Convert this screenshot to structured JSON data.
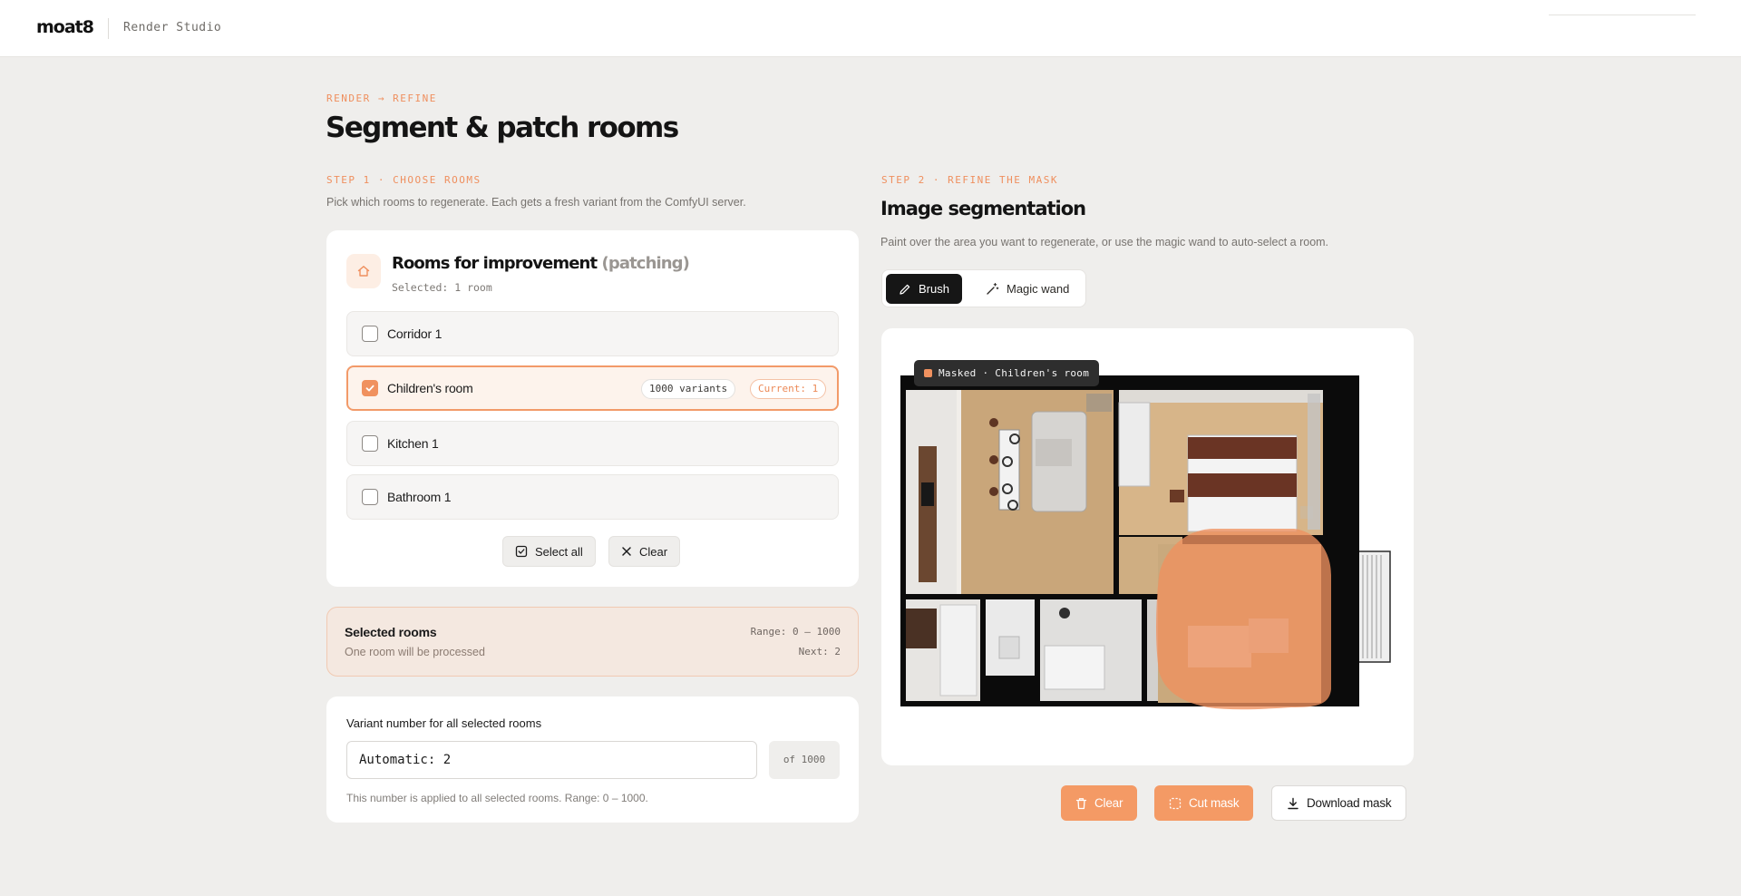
{
  "header": {
    "logo": "moat8",
    "app_name": "Render Studio"
  },
  "breadcrumb": "RENDER → REFINE",
  "page_title": "Segment & patch rooms",
  "step1": {
    "eyebrow": "STEP 1 · CHOOSE ROOMS",
    "description": "Pick which rooms to regenerate. Each gets a fresh variant from the ComfyUI server."
  },
  "rooms_card": {
    "title": "Rooms for improvement",
    "title_suffix": "(patching)",
    "selected_text": "Selected: 1 room",
    "rooms": [
      {
        "label": "Corridor 1",
        "checked": false
      },
      {
        "label": "Children's room",
        "checked": true,
        "variants": "1000 variants",
        "current": "Current: 1"
      },
      {
        "label": "Kitchen 1",
        "checked": false
      },
      {
        "label": "Bathroom 1",
        "checked": false
      }
    ],
    "select_all_label": "Select all",
    "clear_label": "Clear"
  },
  "summary": {
    "title": "Selected rooms",
    "subtitle": "One room will be processed",
    "range": "Range: 0 – 1000",
    "next": "Next: 2"
  },
  "variant": {
    "label": "Variant number for all selected rooms",
    "value": "Automatic: 2",
    "of": "of 1000",
    "help": "This number is applied to all selected rooms. Range: 0 – 1000."
  },
  "step2": {
    "eyebrow": "STEP 2 · REFINE THE MASK",
    "title": "Image segmentation",
    "description": "Paint over the area you want to regenerate, or use the magic wand to auto-select a room."
  },
  "tools": {
    "brush_label": "Brush",
    "wand_label": "Magic wand",
    "active": "brush"
  },
  "canvas": {
    "tag": "Masked · Children's room",
    "mask_color": "#f0915f"
  },
  "actions": {
    "clear_label": "Clear",
    "cut_label": "Cut mask",
    "download_label": "Download mask"
  },
  "colors": {
    "accent": "#f0915f",
    "background": "#efeeec"
  }
}
